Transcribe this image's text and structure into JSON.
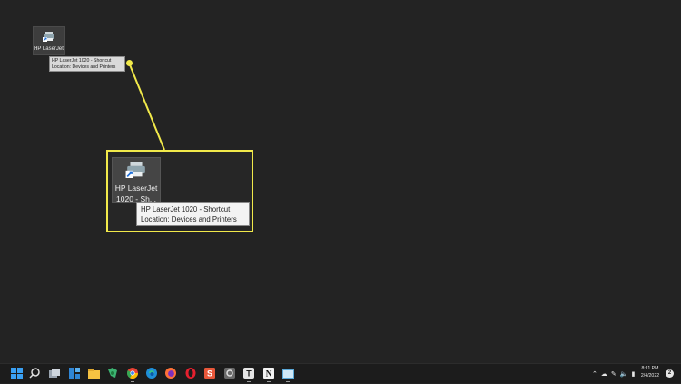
{
  "desktop": {
    "small_shortcut": {
      "label": "HP LaserJet 1020 - Sh...",
      "tooltip_line1": "HP LaserJet 1020 - Shortcut",
      "tooltip_line2": "Location: Devices and Printers"
    },
    "zoomed_shortcut": {
      "label_line1": "HP LaserJet",
      "label_line2": "1020 - Sh...",
      "tooltip_line1": "HP LaserJet 1020 - Shortcut",
      "tooltip_line2": "Location: Devices and Printers"
    },
    "highlight_color": "#f1e94a"
  },
  "taskbar": {
    "apps": [
      {
        "name": "start-icon"
      },
      {
        "name": "search-icon"
      },
      {
        "name": "task-view-icon"
      },
      {
        "name": "widgets-icon"
      },
      {
        "name": "file-explorer-icon"
      },
      {
        "name": "chat-app-icon"
      },
      {
        "name": "chrome-icon"
      },
      {
        "name": "edge-icon"
      },
      {
        "name": "firefox-icon"
      },
      {
        "name": "opera-icon"
      },
      {
        "name": "app-s-icon"
      },
      {
        "name": "app-gear-icon"
      },
      {
        "name": "typora-icon"
      },
      {
        "name": "notion-icon"
      },
      {
        "name": "app-window-icon"
      }
    ],
    "tray": {
      "clock_time": "8:11 PM",
      "clock_date": "2/4/2022",
      "notification_count": "2"
    }
  }
}
